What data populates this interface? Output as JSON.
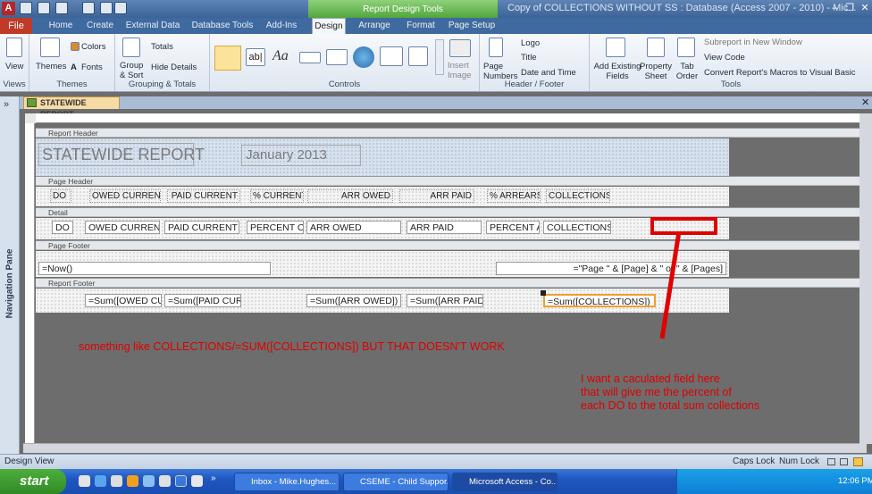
{
  "window": {
    "context_header": "Report Design Tools",
    "title": "Copy of COLLECTIONS WITHOUT SS : Database (Access 2007 - 2010)  -  Mic...",
    "controls": [
      "–",
      "❐",
      "✕"
    ]
  },
  "tabs": [
    "File",
    "Home",
    "Create",
    "External Data",
    "Database Tools",
    "Add-Ins",
    "Design",
    "Arrange",
    "Format",
    "Page Setup"
  ],
  "ribbon": {
    "groups": [
      {
        "label": "Views",
        "buttons": [
          "View"
        ]
      },
      {
        "label": "Themes",
        "buttons": [
          "Themes",
          "Colors",
          "Fonts"
        ]
      },
      {
        "label": "Grouping & Totals",
        "buttons": [
          "Group & Sort",
          "Totals",
          "Hide Details"
        ]
      },
      {
        "label": "Controls",
        "buttons": [
          "Insert Image"
        ]
      },
      {
        "label": "Header / Footer",
        "buttons": [
          "Page Numbers",
          "Logo",
          "Title",
          "Date and Time"
        ]
      },
      {
        "label": "Tools",
        "buttons": [
          "Add Existing Fields",
          "Property Sheet",
          "Tab Order",
          "Subreport in New Window",
          "View Code",
          "Convert Report's Macros to Visual Basic"
        ]
      }
    ]
  },
  "nav_pane": {
    "label": "Navigation Pane",
    "chevron": "»"
  },
  "document_tab": "STATEWIDE REPORT",
  "sections": {
    "report_header": "Report Header",
    "page_header": "Page Header",
    "detail": "Detail",
    "page_footer": "Page Footer",
    "report_footer": "Report Footer"
  },
  "report_header": {
    "title": "STATEWIDE REPORT",
    "date": "January 2013"
  },
  "page_header_labels": [
    "DO",
    "OWED CURRENT",
    "PAID CURRENT",
    "% CURRENT",
    "ARR OWED",
    "ARR PAID",
    "% ARREARS",
    "COLLECTIONS"
  ],
  "detail_fields": [
    "DO",
    "OWED CURRENT",
    "PAID CURRENT",
    "PERCENT CU",
    "ARR OWED",
    "ARR PAID",
    "PERCENT AR",
    "COLLECTIONS"
  ],
  "page_footer": {
    "now": "=Now()",
    "page": "=\"Page \" & [Page] & \" of \" & [Pages]"
  },
  "report_footer": [
    "=Sum([OWED CU",
    "=Sum([PAID CURI",
    "=Sum([ARR OWED])",
    "=Sum([ARR PAID]",
    "=Sum([COLLECTIONS])"
  ],
  "annotations": {
    "note_left": "something like COLLECTIONS/=SUM([COLLECTIONS]) BUT THAT DOESN'T WORK",
    "note_right": [
      "I want a caculated field here",
      "that will give me the percent of",
      "each DO to the total sum collections"
    ]
  },
  "status": {
    "left": "Design View",
    "caps": "Caps Lock",
    "num": "Num Lock"
  },
  "taskbar": {
    "start": "start",
    "buttons": [
      "Inbox - Mike.Hughes...",
      "CSEME - Child Suppor...",
      "Microsoft Access - Co..."
    ],
    "clock": "12:06 PM",
    "chevron": "»"
  },
  "colors": {
    "annotation": "#e00000",
    "file_tab": "#c03a27",
    "context_tab": "#4ea43a"
  }
}
